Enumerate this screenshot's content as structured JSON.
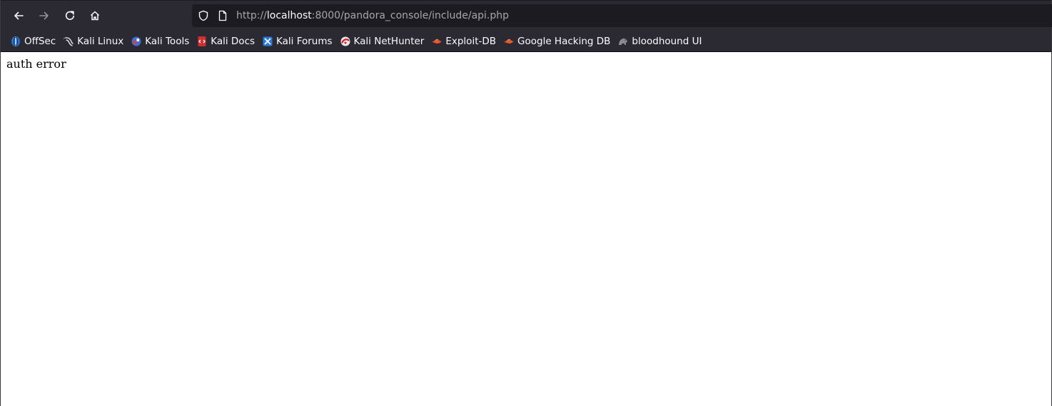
{
  "browser": {
    "nav": {
      "back_icon": "arrow-left-icon",
      "forward_icon": "arrow-right-icon",
      "reload_icon": "reload-icon",
      "home_icon": "home-icon"
    },
    "urlbar": {
      "scheme": "http://",
      "host": "localhost",
      "rest": ":8000/pandora_console/include/api.php",
      "shield_icon": "tracking-shield-icon",
      "page_icon": "page-icon"
    },
    "bookmarks": [
      {
        "label": "OffSec",
        "icon": "offsec-icon"
      },
      {
        "label": "Kali Linux",
        "icon": "kali-dragon-icon"
      },
      {
        "label": "Kali Tools",
        "icon": "kali-tools-icon"
      },
      {
        "label": "Kali Docs",
        "icon": "kali-docs-icon"
      },
      {
        "label": "Kali Forums",
        "icon": "kali-forums-icon"
      },
      {
        "label": "Kali NetHunter",
        "icon": "nethunter-icon"
      },
      {
        "label": "Exploit-DB",
        "icon": "exploit-db-icon"
      },
      {
        "label": "Google Hacking DB",
        "icon": "ghdb-icon"
      },
      {
        "label": "bloodhound UI",
        "icon": "bloodhound-icon"
      }
    ],
    "colors": {
      "toolbar_bg": "#2b2a33",
      "urlbar_bg": "#1c1b22",
      "text_light": "#fbfbfe",
      "text_muted": "#a6a5ab"
    }
  },
  "page": {
    "body_text": "auth error"
  }
}
